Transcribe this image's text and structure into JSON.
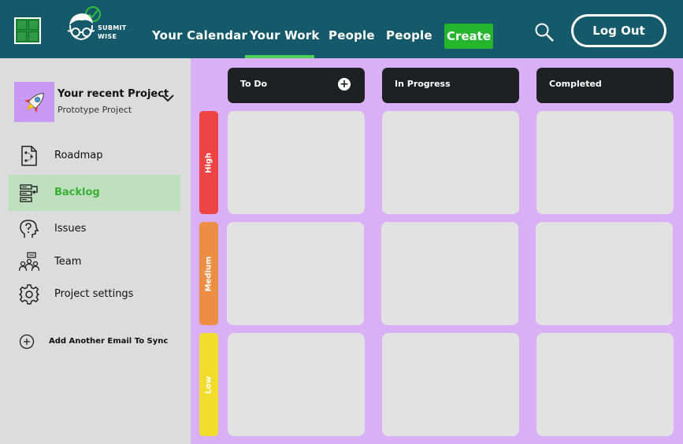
{
  "header": {
    "brand_line1": "SUBMIT",
    "brand_line2": "WISE",
    "nav": [
      {
        "label": "Your Calendar"
      },
      {
        "label": "Your Work"
      },
      {
        "label": "People"
      },
      {
        "label": "People"
      }
    ],
    "active_nav": "Your Work",
    "create_label": "Create",
    "logout_label": "Log Out"
  },
  "sidebar": {
    "project_title": "Your recent Project",
    "project_subtitle": "Prototype Project",
    "items": [
      {
        "label": "Roadmap",
        "icon": "roadmap-icon"
      },
      {
        "label": "Backlog",
        "icon": "backlog-icon",
        "active": true
      },
      {
        "label": "Issues",
        "icon": "issues-icon"
      },
      {
        "label": "Team",
        "icon": "team-icon"
      },
      {
        "label": "Project settings",
        "icon": "gear-icon"
      }
    ],
    "sync_label": "Add Another Email To Sync"
  },
  "board": {
    "columns": [
      {
        "label": "To Do",
        "add": "+"
      },
      {
        "label": "In Progress"
      },
      {
        "label": "Completed"
      }
    ],
    "rows": [
      {
        "label": "High",
        "color": "#ef4444"
      },
      {
        "label": "Medium",
        "color": "#ec8f45"
      },
      {
        "label": "Low",
        "color": "#f2dc2c"
      }
    ]
  },
  "colors": {
    "header_bg": "#155a6a",
    "accent_green": "#24b52d",
    "board_bg": "#d9b0f6",
    "column_header_bg": "#1e2124",
    "active_item_bg": "#bfe0be"
  }
}
